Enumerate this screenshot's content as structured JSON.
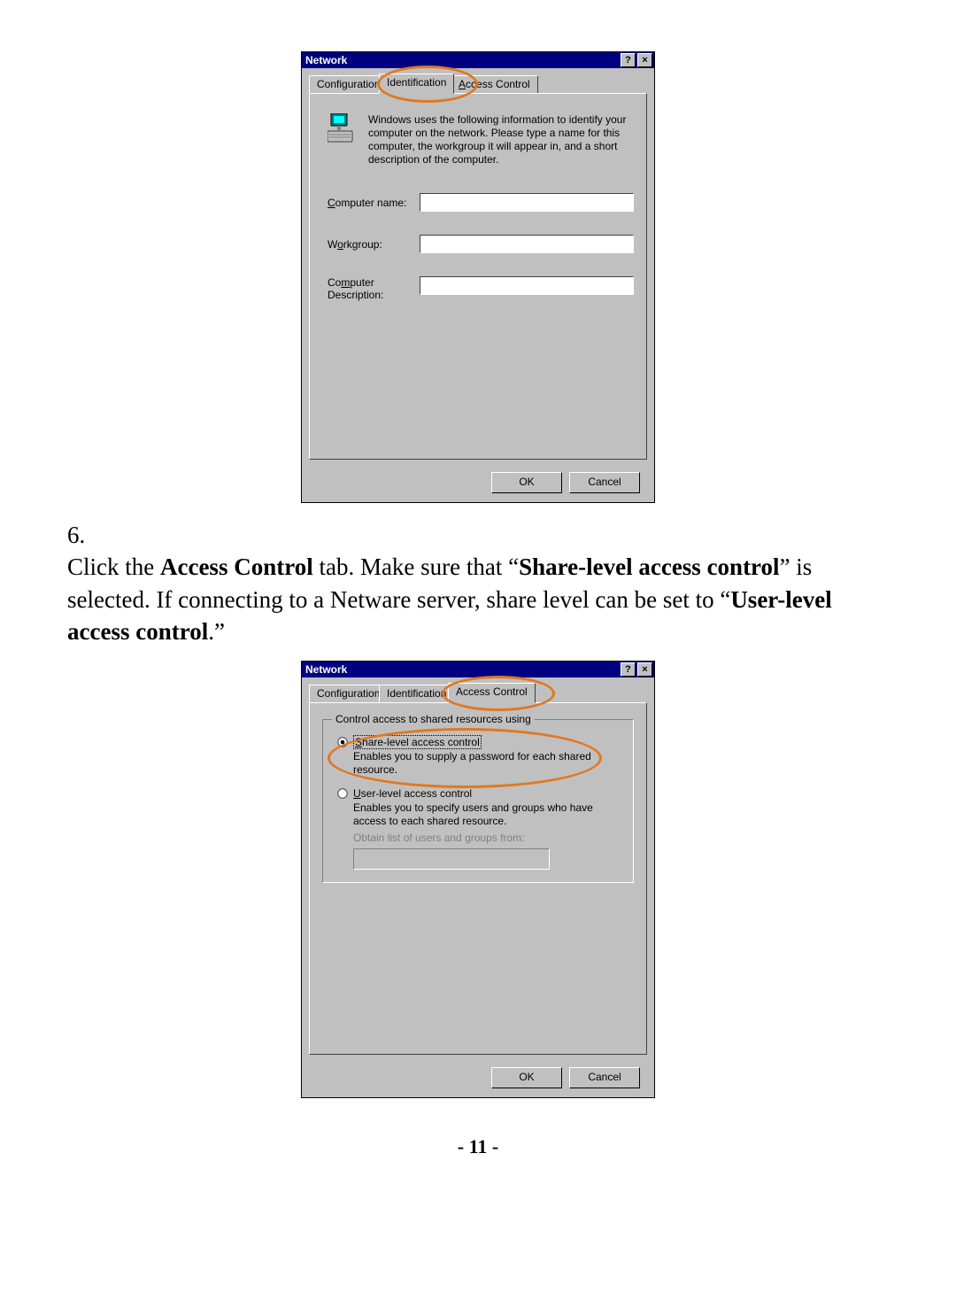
{
  "dialog1": {
    "title": "Network",
    "help_btn": "?",
    "close_btn": "×",
    "tabs": {
      "configuration": "Configuration",
      "identification": "Identification",
      "access_control": "Access Control"
    },
    "info_text": "Windows uses the following information to identify your computer on the network.  Please type a name for this computer, the workgroup it will appear in, and a short description of the computer.",
    "labels": {
      "computer_name": "Computer name:",
      "workgroup": "Workgroup:",
      "description": "Computer Description:"
    },
    "fields": {
      "computer_name": "",
      "workgroup": "",
      "description": ""
    },
    "ok": "OK",
    "cancel": "Cancel"
  },
  "step6": {
    "number": "6.",
    "text_a": "Click the ",
    "bold_a": "Access Control",
    "text_b": " tab.    Make sure that “",
    "bold_b": "Share-level access control",
    "text_c": "” is selected.    If connecting to a Netware server, share level can be set to “",
    "bold_c": "User-level access control",
    "text_d": ".”"
  },
  "dialog2": {
    "title": "Network",
    "help_btn": "?",
    "close_btn": "×",
    "tabs": {
      "configuration": "Configuration",
      "identification": "Identification",
      "access_control": "Access Control"
    },
    "group_legend": "Control access to shared resources using",
    "radio1": {
      "label": "Share-level access control",
      "desc": "Enables you to supply a password for each shared resource."
    },
    "radio2": {
      "label": "User-level access control",
      "desc": "Enables you to specify users and groups who have access to each shared resource.",
      "obtain_label": "Obtain list of users and groups from:"
    },
    "ok": "OK",
    "cancel": "Cancel"
  },
  "page_number": "- 11 -"
}
